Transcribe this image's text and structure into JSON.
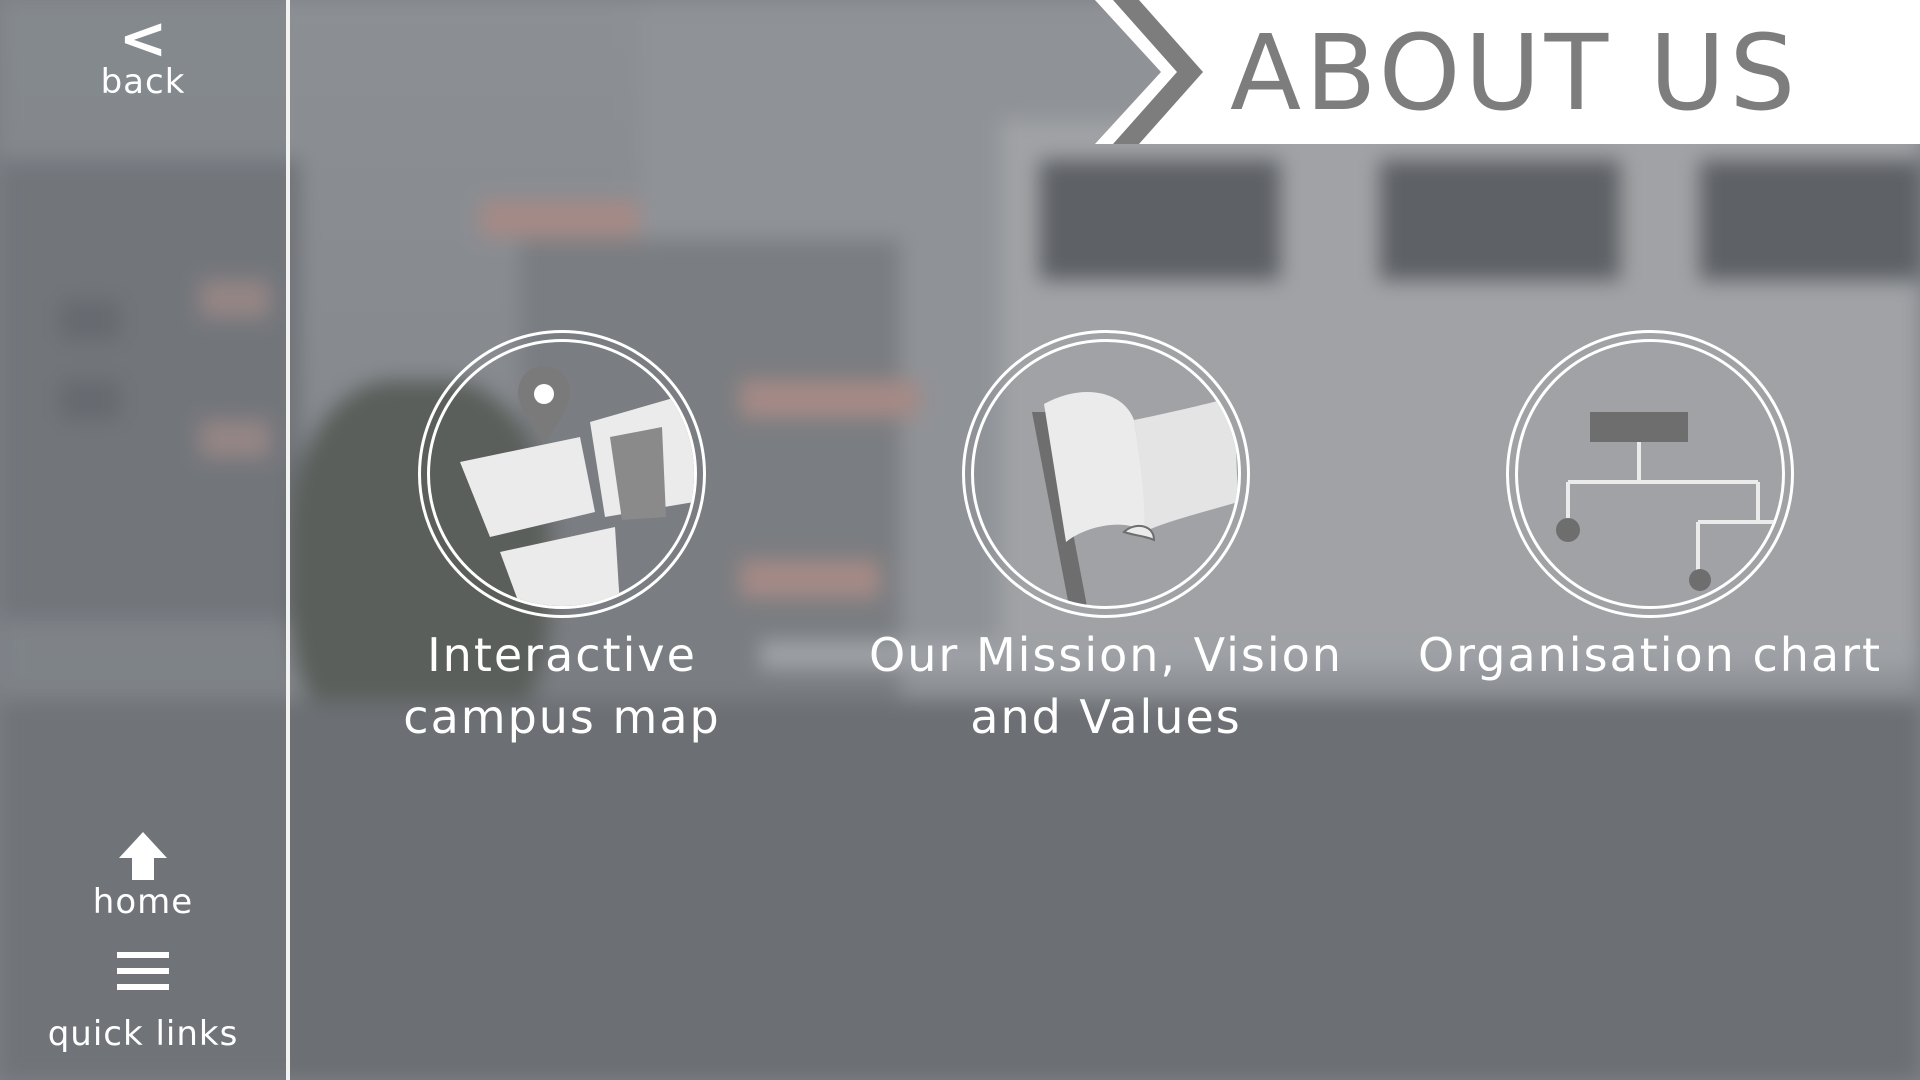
{
  "header": {
    "title": "ABOUT US"
  },
  "sidebar": {
    "back_label": "back",
    "home_label": "home",
    "quick_links_label": "quick links",
    "back_icon": "chevron-left-icon",
    "home_icon": "arrow-up-icon",
    "quick_links_icon": "hamburger-menu-icon"
  },
  "tiles": [
    {
      "title": "Interactive\ncampus map",
      "icon": "map-pin-icon"
    },
    {
      "title": "Our Mission, Vision\nand Values",
      "icon": "flag-icon"
    },
    {
      "title": "Organisation chart",
      "icon": "org-chart-icon"
    }
  ],
  "colors": {
    "banner_bg": "#ffffff",
    "banner_text": "#7d7d7d",
    "icon_fill": "#ebebeb",
    "icon_dark": "#777777"
  }
}
